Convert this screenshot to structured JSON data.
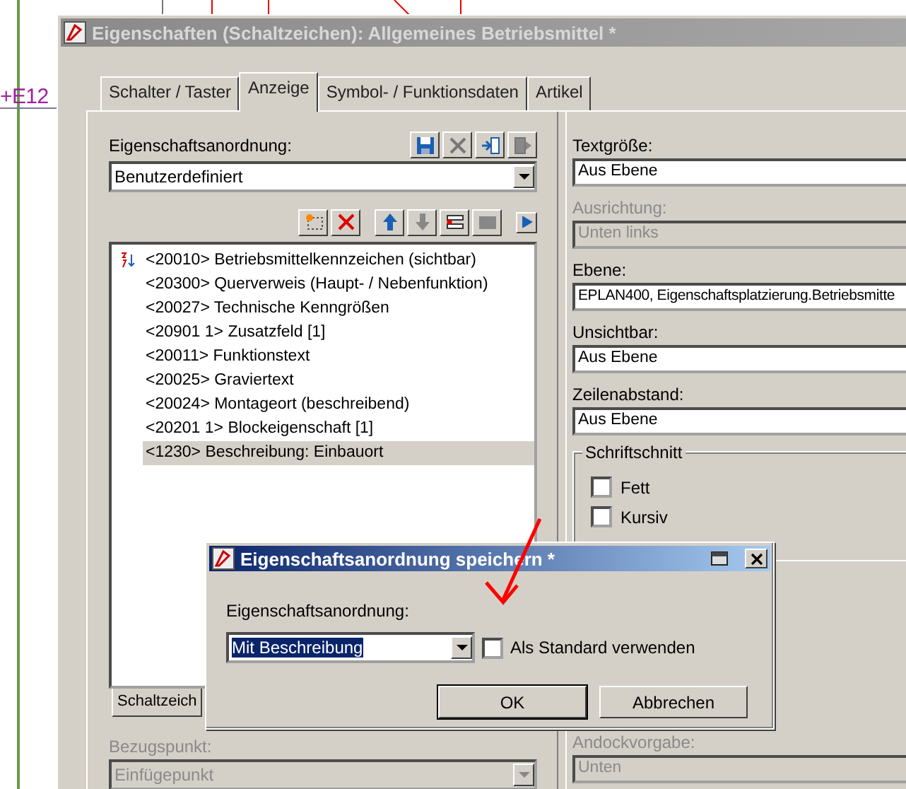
{
  "background": {
    "label": "+E12"
  },
  "window": {
    "title": "Eigenschaften (Schaltzeichen): Allgemeines Betriebsmittel *",
    "active": false
  },
  "tabs": [
    {
      "label": "Schalter / Taster",
      "selected": false
    },
    {
      "label": "Anzeige",
      "selected": true
    },
    {
      "label": "Symbol- / Funktionsdaten",
      "selected": false
    },
    {
      "label": "Artikel",
      "selected": false
    }
  ],
  "arrangement": {
    "label": "Eigenschaftsanordnung:",
    "value": "Benutzerdefiniert"
  },
  "property_list": [
    {
      "text": "<20010> Betriebsmittelkennzeichen (sichtbar)",
      "selected": false
    },
    {
      "text": "<20300> Querverweis (Haupt- / Nebenfunktion)",
      "selected": false
    },
    {
      "text": "<20027> Technische Kenngrößen",
      "selected": false
    },
    {
      "text": "<20901 1> Zusatzfeld [1]",
      "selected": false
    },
    {
      "text": "<20011> Funktionstext",
      "selected": false
    },
    {
      "text": "<20025> Graviertext",
      "selected": false
    },
    {
      "text": "<20024> Montageort (beschreibend)",
      "selected": false
    },
    {
      "text": "<20201 1> Blockeigenschaft [1]",
      "selected": false
    },
    {
      "text": "<1230> Beschreibung: Einbauort",
      "selected": true
    }
  ],
  "bottom_tab": "Schaltzeich",
  "properties": [
    {
      "label": "Textgröße:",
      "value": "Aus Ebene",
      "disabled": false
    },
    {
      "label": "Ausrichtung:",
      "value": "Unten links",
      "disabled": true
    },
    {
      "label": "Ebene:",
      "value": "EPLAN400, Eigenschaftsplatzierung.Betriebsmitte",
      "disabled": false
    },
    {
      "label": "Unsichtbar:",
      "value": "Aus Ebene",
      "disabled": false
    },
    {
      "label": "Zeilenabstand:",
      "value": "Aus Ebene",
      "disabled": false
    }
  ],
  "font_style": {
    "title": "Schriftschnitt",
    "options": [
      {
        "label": "Fett",
        "checked": false
      },
      {
        "label": "Kursiv",
        "checked": false
      }
    ]
  },
  "reference_point": {
    "label": "Bezugspunkt:",
    "value": "Einfügepunkt",
    "disabled": true
  },
  "docking": {
    "label": "Andockvorgabe:",
    "value": "Unten",
    "disabled": true
  },
  "dialog": {
    "title": "Eigenschaftsanordnung speichern *",
    "active": true,
    "label": "Eigenschaftsanordnung:",
    "value": "Mit Beschreibung",
    "default_option": {
      "label": "Als Standard verwenden",
      "checked": false
    },
    "buttons": [
      {
        "label": "OK",
        "default": true
      },
      {
        "label": "Abbrechen",
        "default": false
      }
    ]
  }
}
